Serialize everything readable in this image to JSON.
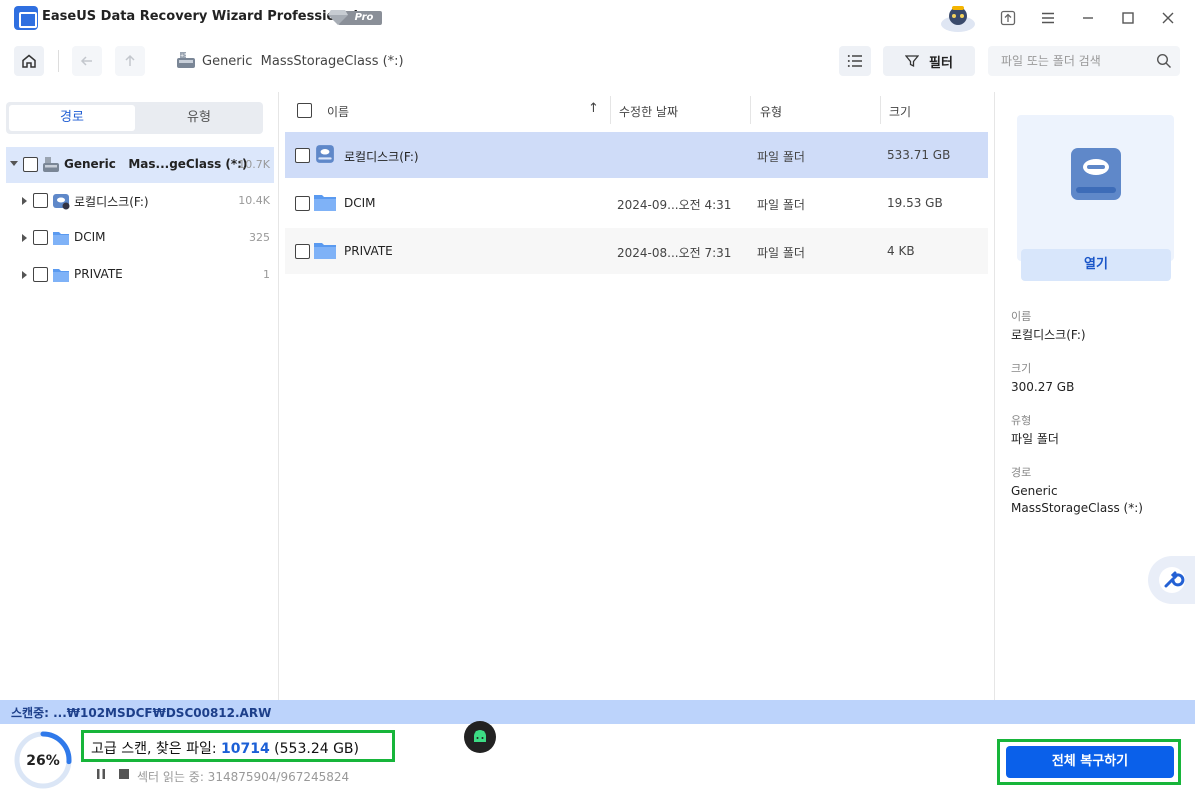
{
  "app": {
    "title": "EaseUS Data Recovery Wizard Professional",
    "badge": "Pro"
  },
  "toolbar": {
    "breadcrumb": "Generic  MassStorageClass (*:)",
    "filter_label": "필터",
    "search_placeholder": "파일 또는 폴더 검색"
  },
  "left": {
    "tabs": [
      "경로",
      "유형"
    ],
    "tree": [
      {
        "label": "Generic   Mas...geClass (*:)",
        "count": "10.7K",
        "icon": "drive-icon"
      },
      {
        "label": "로컬디스크(F:)",
        "count": "10.4K",
        "icon": "local-disk-icon"
      },
      {
        "label": "DCIM",
        "count": "325",
        "icon": "folder-icon"
      },
      {
        "label": "PRIVATE",
        "count": "1",
        "icon": "folder-icon"
      }
    ]
  },
  "list": {
    "headers": {
      "name": "이름",
      "date": "수정한 날짜",
      "type": "유형",
      "size": "크기"
    },
    "sort_indicator": "↑",
    "rows": [
      {
        "name": "로컬디스크(F:)",
        "date": "",
        "type": "파일 폴더",
        "size": "533.71 GB",
        "icon": "local-disk-icon"
      },
      {
        "name": "DCIM",
        "date": "2024-09...오전 4:31",
        "type": "파일 폴더",
        "size": "19.53 GB",
        "icon": "folder-icon"
      },
      {
        "name": "PRIVATE",
        "date": "2024-08...오전 7:31",
        "type": "파일 폴더",
        "size": "4 KB",
        "icon": "folder-icon"
      }
    ]
  },
  "preview": {
    "open_label": "열기",
    "name_label": "이름",
    "name_value": "로컬디스크(F:)",
    "size_label": "크기",
    "size_value": "300.27 GB",
    "type_label": "유형",
    "type_value": "파일 폴더",
    "path_label": "경로",
    "path_value": "Generic MassStorageClass (*:)"
  },
  "status": {
    "scanning": "스캔중: ...₩102MSDCF₩DSC00812.ARW",
    "progress_text": "26%",
    "progress_fraction": 0.26,
    "summary_prefix": "고급 스캔, 찾은 파일: ",
    "found_count": "10714",
    "found_size": " (553.24 GB)",
    "sector_text": "섹터 읽는 중: 314875904/967245824",
    "recover_all": "전체 복구하기"
  },
  "colors": {
    "accent": "#0a60ea",
    "highlight_outline": "#17b53a",
    "selection": "#cfdcf8",
    "scan_bar": "#bcd3fb"
  }
}
